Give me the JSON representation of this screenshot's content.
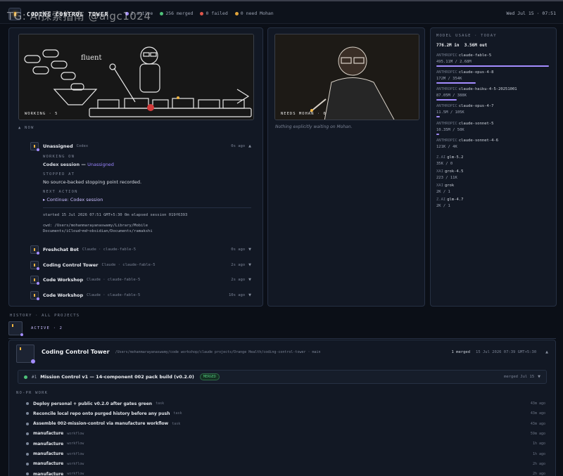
{
  "watermark": "TG: AI探索指南 @aigc1024",
  "app": {
    "title": "CODING CONTROL TOWER"
  },
  "stats": [
    {
      "label": "2 active",
      "color": "#a48cff"
    },
    {
      "label": "256 merged",
      "color": "#4fc27a"
    },
    {
      "label": "0 failed",
      "color": "#e0564b"
    },
    {
      "label": "0 need Mohan",
      "color": "#e0a33a"
    }
  ],
  "clock": "Wed Jul 15 · 07:51",
  "working_panel": {
    "label": "WORKING · 5",
    "fluent": "fluent",
    "section": "▲ NOW",
    "expanded": {
      "name": "Unassigned",
      "agent": "Codex",
      "ago": "0s ago",
      "working_on_label": "WORKING ON",
      "working_on": "Codex session — ",
      "working_on_status": "Unassigned",
      "stopped_label": "STOPPED AT",
      "stopped": "No source-backed stopping point recorded.",
      "next_label": "NEXT ACTION",
      "next": "▸ Continue: Codex session",
      "meta": "started 15 Jul 2026 07:51 GMT+5:30   0m elapsed   session 019f6393",
      "cwd_line1": "cwd: /Users/mohanmarayanaswamy/Library/Mobile",
      "cwd_line2": "Documents/iCloud~md~obsidian/Documents/ramakshi"
    },
    "rows": [
      {
        "name": "Freshchat Bot",
        "agent": "Claude · claude-fable-5",
        "ago": "0s ago"
      },
      {
        "name": "Coding Control Tower",
        "agent": "Claude · claude-fable-5",
        "ago": "2s ago"
      },
      {
        "name": "Code Workshop",
        "agent": "Claude · claude-fable-5",
        "ago": "2s ago"
      },
      {
        "name": "Code Workshop",
        "agent": "Claude · claude-fable-5",
        "ago": "10s ago"
      }
    ]
  },
  "mohan_panel": {
    "label": "NEEDS MOHAN · 0",
    "empty": "Nothing explicitly waiting on Mohan."
  },
  "model_usage": {
    "title": "MODEL USAGE · TODAY",
    "total_in": "776.2M in",
    "total_out": "3.56M out",
    "items": [
      {
        "provider": "ANTHROPIC",
        "model": "claude-fable-5",
        "value": "495.11M / 2.68M",
        "fill": 1.0
      },
      {
        "provider": "ANTHROPIC",
        "model": "claude-opus-4-8",
        "value": "172M / 354K",
        "fill": 0.35
      },
      {
        "provider": "ANTHROPIC",
        "model": "claude-haiku-4-5-20251001",
        "value": "87.05M / 388K",
        "fill": 0.18
      },
      {
        "provider": "ANTHROPIC",
        "model": "claude-opus-4-7",
        "value": "11.5M / 105K",
        "fill": 0.03
      },
      {
        "provider": "ANTHROPIC",
        "model": "claude-sonnet-5",
        "value": "10.35M / 50K",
        "fill": 0.025
      },
      {
        "provider": "ANTHROPIC",
        "model": "claude-sonnet-4-6",
        "value": "121K / 4K",
        "fill": 0
      },
      {
        "provider": "Z.AI",
        "model": "glm-5.2",
        "value": "35K / 0",
        "fill": 0
      },
      {
        "provider": "XAI",
        "model": "grok-4.5",
        "value": "223 / 11K",
        "fill": 0
      },
      {
        "provider": "XAI",
        "model": "grok",
        "value": "2K / 1",
        "fill": 0
      },
      {
        "provider": "Z.AI",
        "model": "glm-4.7",
        "value": "2K / 1",
        "fill": 0
      }
    ]
  },
  "history": {
    "label": "HISTORY · ALL PROJECTS",
    "active_label": "ACTIVE · 2",
    "project": {
      "name": "Coding Control Tower",
      "path": "/Users/mohanmarayanaswamy/code workshop/claude projects/Orange Health/coding-control-tower · main",
      "merged": "1 merged",
      "date": "15 Jul 2026 07:39 GMT+5:30",
      "pr_number": "#1",
      "pr_title": "Mission Control v1 — 14-component 002 pack build (v0.2.0)",
      "pr_badge": "MERGED",
      "pr_date": "merged Jul 15",
      "no_pr_label": "NO-PR WORK",
      "tasks": [
        {
          "title": "Deploy personal + public v0.2.0 after gates green",
          "kind": "task",
          "ago": "43m ago"
        },
        {
          "title": "Reconcile local repo onto purged history before any push",
          "kind": "task",
          "ago": "43m ago"
        },
        {
          "title": "Assemble 002-mission-control via manufacture workflow",
          "kind": "task",
          "ago": "43m ago"
        },
        {
          "title": "manufacture",
          "kind": "workflow",
          "ago": "59m ago"
        },
        {
          "title": "manufacture",
          "kind": "workflow",
          "ago": "1h ago"
        },
        {
          "title": "manufacture",
          "kind": "workflow",
          "ago": "1h ago"
        },
        {
          "title": "manufacture",
          "kind": "workflow",
          "ago": "2h ago"
        },
        {
          "title": "manufacture",
          "kind": "workflow",
          "ago": "2h ago"
        }
      ]
    }
  }
}
